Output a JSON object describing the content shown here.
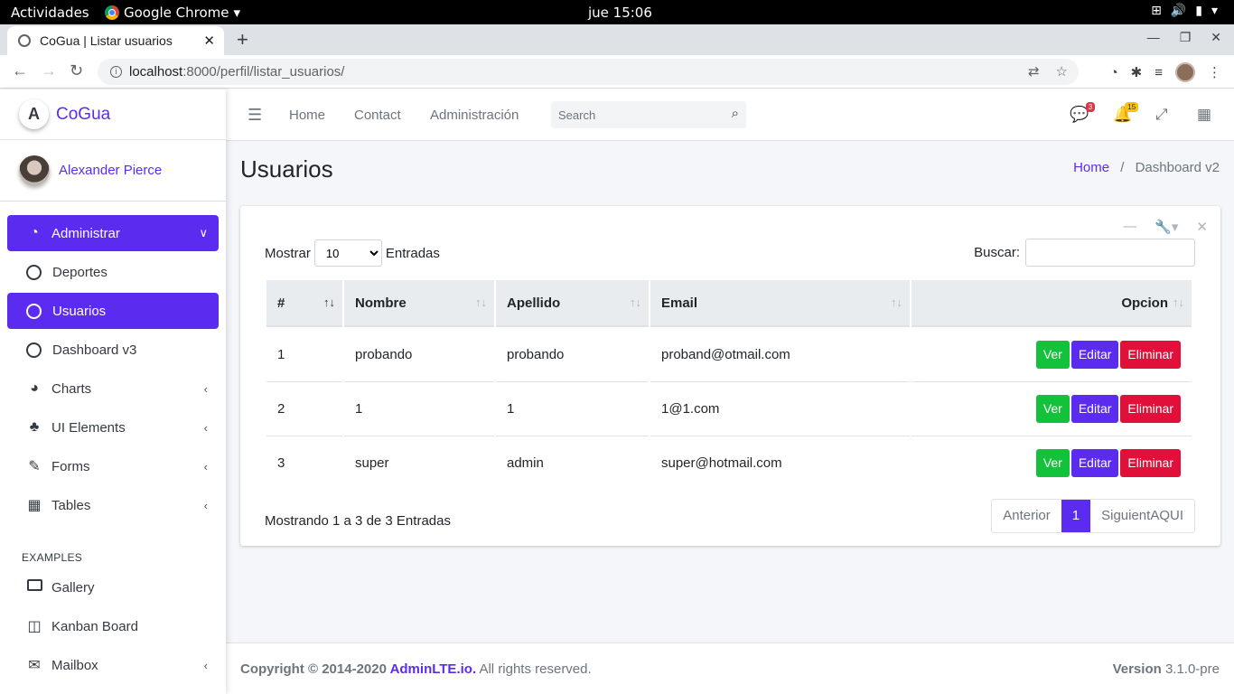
{
  "os_bar": {
    "activities": "Actividades",
    "app_name": "Google Chrome",
    "clock": "jue 15:06"
  },
  "browser": {
    "tab_title": "CoGua | Listar usuarios",
    "url_host": "localhost",
    "url_path": ":8000/perfil/listar_usuarios/"
  },
  "sidebar": {
    "brand": "CoGua",
    "brand_letter": "A",
    "user_name": "Alexander Pierce",
    "items": [
      {
        "label": "Administrar",
        "icon": "tachometer-icon",
        "active": true
      },
      {
        "label": "Deportes",
        "icon": "circle-icon"
      },
      {
        "label": "Usuarios",
        "icon": "circle-icon",
        "active": true
      },
      {
        "label": "Dashboard v3",
        "icon": "circle-icon"
      },
      {
        "label": "Charts",
        "icon": "pie-chart-icon"
      },
      {
        "label": "UI Elements",
        "icon": "tree-icon"
      },
      {
        "label": "Forms",
        "icon": "edit-icon"
      },
      {
        "label": "Tables",
        "icon": "table-icon"
      }
    ],
    "header_examples": "EXAMPLES",
    "examples": [
      {
        "label": "Gallery",
        "icon": "image-icon"
      },
      {
        "label": "Kanban Board",
        "icon": "columns-icon"
      },
      {
        "label": "Mailbox",
        "icon": "envelope-icon"
      }
    ]
  },
  "header": {
    "links": [
      "Home",
      "Contact",
      "Administración"
    ],
    "search_placeholder": "Search",
    "messages_count": "3",
    "notifications_count": "15"
  },
  "page": {
    "title": "Usuarios",
    "breadcrumb_home": "Home",
    "breadcrumb_current": "Dashboard v2"
  },
  "table_controls": {
    "show_label": "Mostrar",
    "page_size": "10",
    "entries_label": "Entradas",
    "search_label": "Buscar:"
  },
  "table": {
    "columns": [
      "#",
      "Nombre",
      "Apellido",
      "Email",
      "Opcion"
    ],
    "rows": [
      {
        "id": "1",
        "nombre": "probando",
        "apellido": "probando",
        "email": "proband@otmail.com"
      },
      {
        "id": "2",
        "nombre": "1",
        "apellido": "1",
        "email": "1@1.com"
      },
      {
        "id": "3",
        "nombre": "super",
        "apellido": "admin",
        "email": "super@hotmail.com"
      }
    ],
    "actions": {
      "view": "Ver",
      "edit": "Editar",
      "delete": "Eliminar"
    }
  },
  "pagination": {
    "info": "Mostrando 1 a 3 de 3 Entradas",
    "prev": "Anterior",
    "current": "1",
    "next": "SiguientAQUI"
  },
  "footer": {
    "copyright": "Copyright © 2014-2020 ",
    "brand_link": "AdminLTE.io.",
    "rights": " All rights reserved.",
    "version_label": "Version",
    "version": " 3.1.0-pre"
  },
  "colors": {
    "primary": "#5b2cf0",
    "success": "#13c13b",
    "danger": "#e0103a"
  }
}
